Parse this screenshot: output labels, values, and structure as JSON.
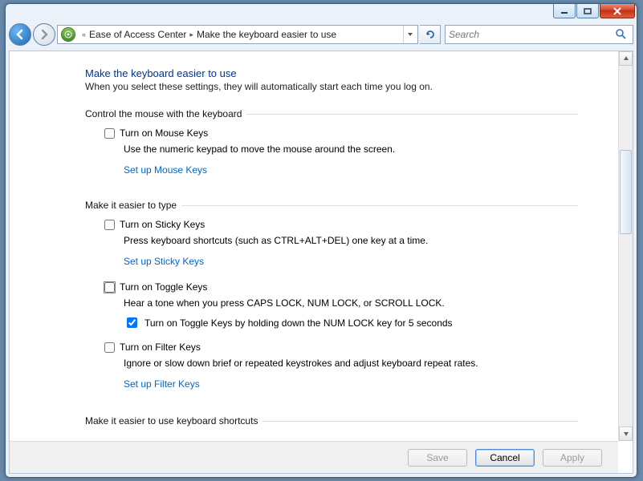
{
  "window": {
    "minimize": "Minimize",
    "maximize": "Maximize",
    "close": "Close"
  },
  "breadcrumb": {
    "chevrons": "«",
    "parent": "Ease of Access Center",
    "sep": "▸",
    "current": "Make the keyboard easier to use"
  },
  "nav": {
    "refresh": "↻"
  },
  "search": {
    "placeholder": "Search"
  },
  "page": {
    "title": "Make the keyboard easier to use",
    "subtitle": "When you select these settings, they will automatically start each time you log on."
  },
  "section1": {
    "head": "Control the mouse with the keyboard",
    "mousekeys_label": "Turn on Mouse Keys",
    "mousekeys_checked": false,
    "mousekeys_desc": "Use the numeric keypad to move the mouse around the screen.",
    "mousekeys_link": "Set up Mouse Keys"
  },
  "section2": {
    "head": "Make it easier to type",
    "sticky_label": "Turn on Sticky Keys",
    "sticky_checked": false,
    "sticky_desc": "Press keyboard shortcuts (such as CTRL+ALT+DEL) one key at a time.",
    "sticky_link": "Set up Sticky Keys",
    "toggle_label": "Turn on Toggle Keys",
    "toggle_checked": false,
    "toggle_desc": "Hear a tone when you press CAPS LOCK, NUM LOCK, or SCROLL LOCK.",
    "toggle_sub_label": "Turn on Toggle Keys by holding down the NUM LOCK key for 5 seconds",
    "toggle_sub_checked": true,
    "filter_label": "Turn on Filter Keys",
    "filter_checked": false,
    "filter_desc": "Ignore or slow down brief or repeated keystrokes and adjust keyboard repeat rates.",
    "filter_link": "Set up Filter Keys"
  },
  "section3": {
    "head": "Make it easier to use keyboard shortcuts"
  },
  "buttons": {
    "save": "Save",
    "cancel": "Cancel",
    "apply": "Apply"
  }
}
